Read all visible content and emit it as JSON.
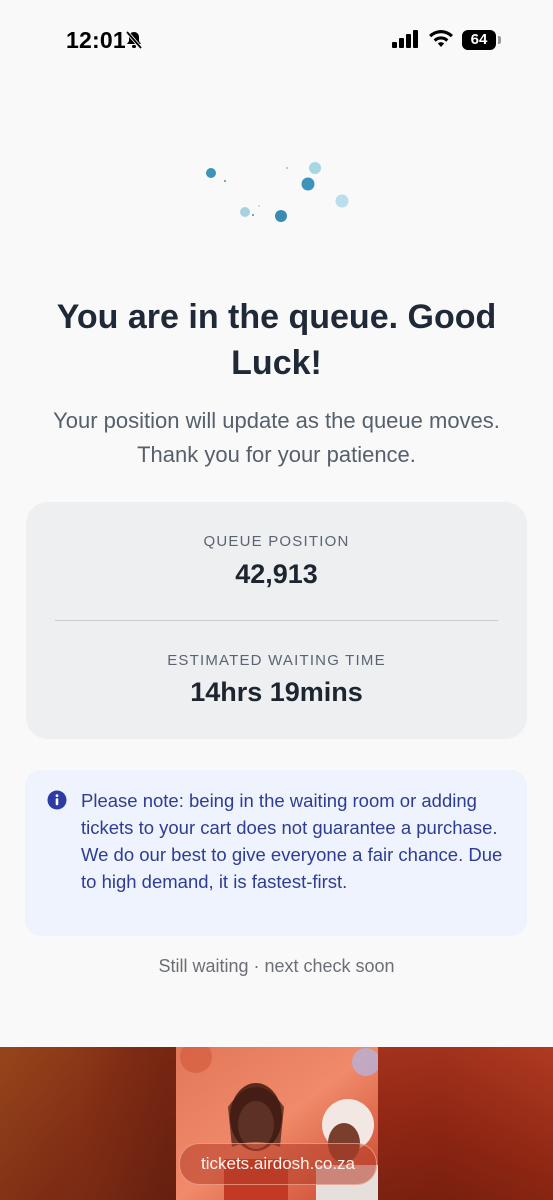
{
  "status_bar": {
    "time": "12:01",
    "battery": "64",
    "icons": [
      "bell-slash-icon",
      "signal-icon",
      "wifi-icon",
      "battery-icon"
    ]
  },
  "loader": {
    "icon": "loading-dots-icon",
    "color": "#3e93b8"
  },
  "headline": "You are in the queue. Good Luck!",
  "subtext": "Your position will update as the queue moves. Thank you for your patience.",
  "queue": {
    "position_label": "QUEUE POSITION",
    "position_value": "42,913",
    "wait_label": "ESTIMATED WAITING TIME",
    "wait_value": "14hrs 19mins"
  },
  "notice": {
    "icon": "info-icon",
    "text": "Please note: being in the waiting room or adding tickets to your cart does not guarantee a purchase. We do our best to give everyone a fair chance. Due to high demand, it is fastest-first."
  },
  "status_line": "Still waiting · next check soon",
  "browser": {
    "url": "tickets.airdosh.co.za"
  },
  "colors": {
    "background": "#f9f9fa",
    "card": "#eeeff1",
    "notice_bg": "#eef3fd",
    "notice_text": "#2e3d93",
    "heading": "#1f2937"
  }
}
